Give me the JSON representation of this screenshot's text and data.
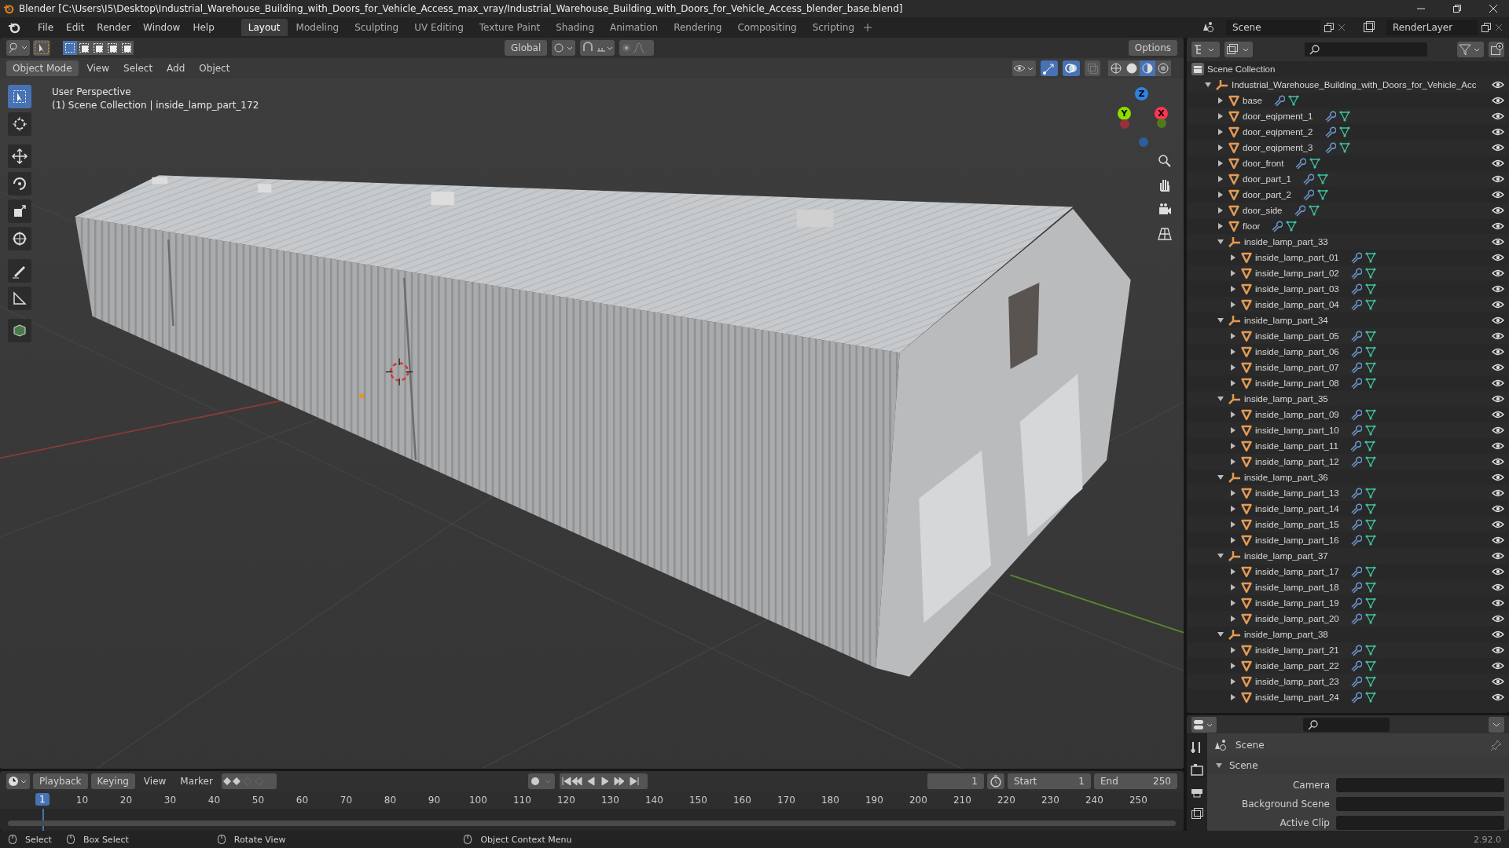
{
  "window": {
    "title": "Blender [C:\\Users\\I5\\Desktop\\Industrial_Warehouse_Building_with_Doors_for_Vehicle_Access_max_vray/Industrial_Warehouse_Building_with_Doors_for_Vehicle_Access_blender_base.blend]"
  },
  "menu": [
    "File",
    "Edit",
    "Render",
    "Window",
    "Help"
  ],
  "workspace_tabs": [
    {
      "label": "Layout",
      "selected": true
    },
    {
      "label": "Modeling",
      "selected": false
    },
    {
      "label": "Sculpting",
      "selected": false
    },
    {
      "label": "UV Editing",
      "selected": false
    },
    {
      "label": "Texture Paint",
      "selected": false
    },
    {
      "label": "Shading",
      "selected": false
    },
    {
      "label": "Animation",
      "selected": false
    },
    {
      "label": "Rendering",
      "selected": false
    },
    {
      "label": "Compositing",
      "selected": false
    },
    {
      "label": "Scripting",
      "selected": false
    }
  ],
  "scene_selector": {
    "value": "Scene"
  },
  "view_layer_selector": {
    "value": "RenderLayer"
  },
  "tool_header": {
    "select_modes": [
      {
        "selected": true
      },
      {
        "selected": false
      },
      {
        "selected": false
      },
      {
        "selected": false
      },
      {
        "selected": false
      }
    ],
    "orientation": "Global",
    "options": "Options"
  },
  "viewport_header": {
    "mode": "Object Mode",
    "menus": [
      "View",
      "Select",
      "Add",
      "Object"
    ],
    "gizmos_on": true,
    "overlays_on": true,
    "shading_modes": [
      {
        "selected": false
      },
      {
        "selected": false
      },
      {
        "selected": true
      },
      {
        "selected": false
      }
    ]
  },
  "viewport": {
    "view_name": "User Perspective",
    "context": "(1) Scene Collection | inside_lamp_part_172",
    "axes": [
      {
        "label": "Z"
      },
      {
        "label": "Y"
      },
      {
        "label": "X"
      }
    ],
    "tools": [
      {
        "kind": "select",
        "selected": true
      },
      {
        "kind": "cursor",
        "selected": false
      },
      {
        "kind": "move",
        "selected": false
      },
      {
        "kind": "rotate",
        "selected": false
      },
      {
        "kind": "scale",
        "selected": false
      },
      {
        "kind": "transform",
        "selected": false
      },
      {
        "kind": "annotate",
        "selected": false
      },
      {
        "kind": "measure",
        "selected": false
      },
      {
        "kind": "add-cube",
        "selected": false
      }
    ]
  },
  "outliner": {
    "tree": [
      {
        "name": "Scene Collection",
        "kind": "scene",
        "children": [
          {
            "name": "Industrial_Warehouse_Building_with_Doors_for_Vehicle_Acc",
            "kind": "collection",
            "expanded": true,
            "children": [
              {
                "name": "base",
                "kind": "object",
                "expanded": false
              },
              {
                "name": "door_eqipment_1",
                "kind": "object",
                "expanded": false
              },
              {
                "name": "door_eqipment_2",
                "kind": "object",
                "expanded": false
              },
              {
                "name": "door_eqipment_3",
                "kind": "object",
                "expanded": false
              },
              {
                "name": "door_front",
                "kind": "object",
                "expanded": false
              },
              {
                "name": "door_part_1",
                "kind": "object",
                "expanded": false
              },
              {
                "name": "door_part_2",
                "kind": "object",
                "expanded": false
              },
              {
                "name": "door_side",
                "kind": "object",
                "expanded": false
              },
              {
                "name": "floor",
                "kind": "object",
                "expanded": false
              },
              {
                "name": "inside_lamp_part_33",
                "kind": "collection",
                "expanded": true,
                "children": [
                  {
                    "name": "inside_lamp_part_01",
                    "kind": "object",
                    "expanded": false
                  },
                  {
                    "name": "inside_lamp_part_02",
                    "kind": "object",
                    "expanded": false
                  },
                  {
                    "name": "inside_lamp_part_03",
                    "kind": "object",
                    "expanded": false
                  },
                  {
                    "name": "inside_lamp_part_04",
                    "kind": "object",
                    "expanded": false
                  }
                ]
              },
              {
                "name": "inside_lamp_part_34",
                "kind": "collection",
                "expanded": true,
                "children": [
                  {
                    "name": "inside_lamp_part_05",
                    "kind": "object",
                    "expanded": false
                  },
                  {
                    "name": "inside_lamp_part_06",
                    "kind": "object",
                    "expanded": false
                  },
                  {
                    "name": "inside_lamp_part_07",
                    "kind": "object",
                    "expanded": false
                  },
                  {
                    "name": "inside_lamp_part_08",
                    "kind": "object",
                    "expanded": false
                  }
                ]
              },
              {
                "name": "inside_lamp_part_35",
                "kind": "collection",
                "expanded": true,
                "children": [
                  {
                    "name": "inside_lamp_part_09",
                    "kind": "object",
                    "expanded": false
                  },
                  {
                    "name": "inside_lamp_part_10",
                    "kind": "object",
                    "expanded": false
                  },
                  {
                    "name": "inside_lamp_part_11",
                    "kind": "object",
                    "expanded": false
                  },
                  {
                    "name": "inside_lamp_part_12",
                    "kind": "object",
                    "expanded": false
                  }
                ]
              },
              {
                "name": "inside_lamp_part_36",
                "kind": "collection",
                "expanded": true,
                "children": [
                  {
                    "name": "inside_lamp_part_13",
                    "kind": "object",
                    "expanded": false
                  },
                  {
                    "name": "inside_lamp_part_14",
                    "kind": "object",
                    "expanded": false
                  },
                  {
                    "name": "inside_lamp_part_15",
                    "kind": "object",
                    "expanded": false
                  },
                  {
                    "name": "inside_lamp_part_16",
                    "kind": "object",
                    "expanded": false
                  }
                ]
              },
              {
                "name": "inside_lamp_part_37",
                "kind": "collection",
                "expanded": true,
                "children": [
                  {
                    "name": "inside_lamp_part_17",
                    "kind": "object",
                    "expanded": false
                  },
                  {
                    "name": "inside_lamp_part_18",
                    "kind": "object",
                    "expanded": false
                  },
                  {
                    "name": "inside_lamp_part_19",
                    "kind": "object",
                    "expanded": false
                  },
                  {
                    "name": "inside_lamp_part_20",
                    "kind": "object",
                    "expanded": false
                  }
                ]
              },
              {
                "name": "inside_lamp_part_38",
                "kind": "collection",
                "expanded": true,
                "children": [
                  {
                    "name": "inside_lamp_part_21",
                    "kind": "object",
                    "expanded": false
                  },
                  {
                    "name": "inside_lamp_part_22",
                    "kind": "object",
                    "expanded": false
                  },
                  {
                    "name": "inside_lamp_part_23",
                    "kind": "object",
                    "expanded": false
                  },
                  {
                    "name": "inside_lamp_part_24",
                    "kind": "object",
                    "expanded": false
                  }
                ]
              }
            ]
          }
        ]
      }
    ]
  },
  "properties": {
    "context": "Scene",
    "panel": {
      "title": "Scene",
      "expanded": true
    },
    "fields": [
      {
        "label": "Camera"
      },
      {
        "label": "Background Scene"
      },
      {
        "label": "Active Clip"
      }
    ]
  },
  "timeline": {
    "menus": [
      "Playback",
      "Keying",
      "View",
      "Marker"
    ],
    "current_frame": "1",
    "start_label": "Start",
    "start": "1",
    "end_label": "End",
    "end": "250",
    "playhead": "1",
    "ruler": [
      "10",
      "20",
      "30",
      "40",
      "50",
      "60",
      "70",
      "80",
      "90",
      "100",
      "110",
      "120",
      "130",
      "140",
      "150",
      "160",
      "170",
      "180",
      "190",
      "200",
      "210",
      "220",
      "230",
      "240",
      "250"
    ]
  },
  "status_bar": {
    "hints": [
      "Select",
      "Box Select",
      "Rotate View",
      "Object Context Menu"
    ],
    "version": "2.92.0"
  }
}
